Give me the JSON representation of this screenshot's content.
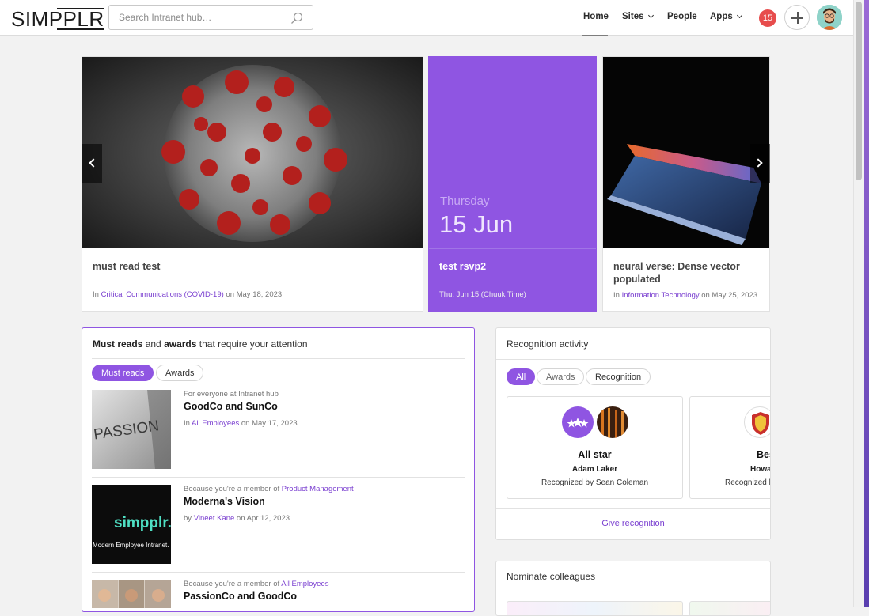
{
  "header": {
    "logo": "SIMPPLR",
    "search_placeholder": "Search Intranet hub…",
    "nav": [
      {
        "label": "Home"
      },
      {
        "label": "Sites"
      },
      {
        "label": "People"
      },
      {
        "label": "Apps"
      }
    ],
    "notification_count": "15"
  },
  "carousel": [
    {
      "title": "must read test",
      "meta_prefix": "In ",
      "meta_link": "Critical Communications (COVID-19)",
      "meta_suffix": " on May 18, 2023"
    },
    {
      "day": "Thursday",
      "date": "15 Jun",
      "title": "test rsvp2",
      "meta": "Thu, Jun 15 (Chuuk Time)"
    },
    {
      "title": "neural verse: Dense vector populated",
      "meta_prefix": "In ",
      "meta_link": "Information Technology",
      "meta_suffix": " on May 25, 2023"
    }
  ],
  "must_reads": {
    "heading_b1": "Must reads",
    "heading_t1": " and ",
    "heading_b2": "awards",
    "heading_t2": " that require your attention",
    "tabs": [
      "Must reads",
      "Awards"
    ],
    "items": [
      {
        "reason_prefix": "For everyone at Intranet hub",
        "reason_link": "",
        "title": "GoodCo and SunCo",
        "by_prefix": "In ",
        "by_link": "All Employees",
        "by_suffix": " on May 17, 2023",
        "thumb_text": "PASSION"
      },
      {
        "reason_prefix": "Because you're a member of ",
        "reason_link": "Product Management",
        "title": "Moderna's Vision",
        "by_prefix": "by ",
        "by_link": "Vineet Kane",
        "by_suffix": " on Apr 12, 2023",
        "thumb_logo": "simpplr.",
        "thumb_caption": "Modern Employee Intranet."
      },
      {
        "reason_prefix": "Because you're a member of ",
        "reason_link": "All Employees",
        "title": "PassionCo and GoodCo"
      }
    ]
  },
  "recognition": {
    "title": "Recognition activity",
    "filters": [
      "All",
      "Awards",
      "Recognition"
    ],
    "cards": [
      {
        "award": "All star",
        "person": "Adam Laker",
        "by": "Recognized by Sean Coleman"
      },
      {
        "award": "Bes",
        "person": "Howa",
        "by": "Recognized l"
      }
    ],
    "give_label": "Give recognition"
  },
  "nominate": {
    "title": "Nominate colleagues"
  },
  "colors": {
    "accent": "#8f55e2",
    "link": "#7a3fd0",
    "badge": "#e74c4c"
  }
}
